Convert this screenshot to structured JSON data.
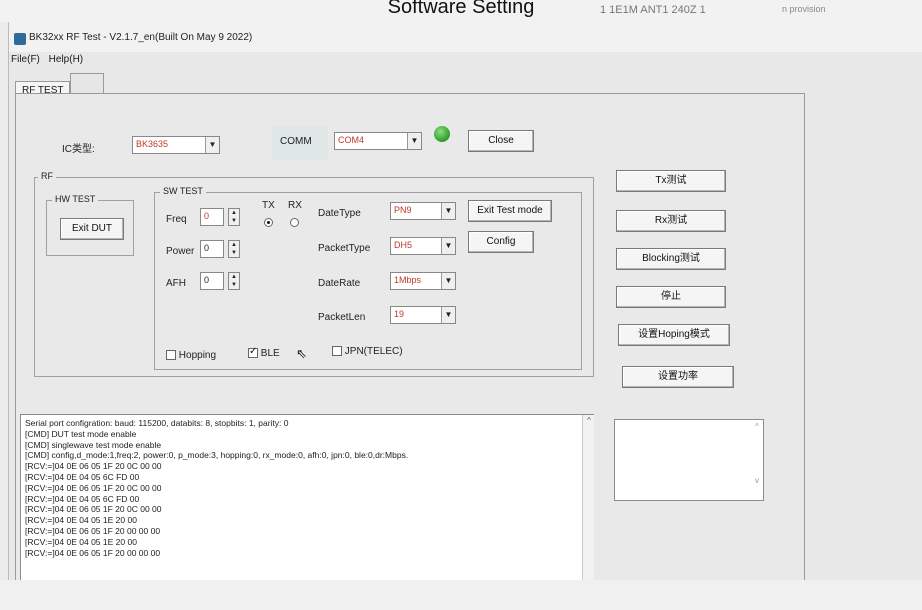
{
  "caption": "Software Setting",
  "background_text": {
    "left": "1  1E1M ANT1 240Z 1",
    "right": "n provision"
  },
  "window": {
    "title": "BK32xx RF Test - V2.1.7_en(Built On May  9 2022)",
    "menu": [
      "File(F)",
      "Help(H)"
    ]
  },
  "tabs": [
    "RF TEST",
    ""
  ],
  "top_row": {
    "ic_label": "IC类型:",
    "ic_value": "BK3635",
    "comm_label": "COMM",
    "comm_value": "COM4",
    "close_label": "Close",
    "led_color": "#2e9a2a"
  },
  "rf_group": {
    "title": "RF",
    "hw_test": {
      "title": "HW TEST",
      "exit_dut_label": "Exit DUT"
    },
    "sw_test": {
      "title": "SW TEST",
      "freq_label": "Freq",
      "freq_value": "0",
      "power_label": "Power",
      "power_value": "0",
      "afh_label": "AFH",
      "afh_value": "0",
      "tx_label": "TX",
      "rx_label": "RX",
      "tx_selected": true,
      "datetype_label": "DateType",
      "datetype_value": "PN9",
      "packettype_label": "PacketType",
      "packettype_value": "DH5",
      "daterate_label": "DateRate",
      "daterate_value": "1Mbps",
      "packetlen_label": "PacketLen",
      "packetlen_value": "19",
      "exit_test_mode_label": "Exit Test mode",
      "config_label": "Config",
      "hopping_label": "Hopping",
      "hopping_checked": false,
      "ble_label": "BLE",
      "ble_checked": true,
      "jpn_label": "JPN(TELEC)",
      "jpn_checked": false
    }
  },
  "right_buttons": [
    "Tx测试",
    "Rx测试",
    "Blocking测试",
    "停止",
    "设置Hoping模式",
    "设置功率"
  ],
  "log_lines": [
    "Serial port configration: baud: 115200, databits: 8, stopbits: 1, parity: 0",
    "[CMD] DUT test mode enable",
    "[CMD] singlewave test mode enable",
    "[CMD] config,d_mode:1,freq:2, power:0, p_mode:3, hopping:0, rx_mode:0, afh:0, jpn:0, ble:0,dr:Mbps.",
    "[RCV:=]04 0E 06 05 1F 20 0C 00 00",
    "[RCV:=]04 0E 04 05 6C FD 00",
    "[RCV:=]04 0E 06 05 1F 20 0C 00 00",
    "[RCV:=]04 0E 04 05 6C FD 00",
    "[RCV:=]04 0E 06 05 1F 20 0C 00 00",
    "[RCV:=]04 0E 04 05 1E 20 00",
    "[RCV:=]04 0E 06 05 1F 20 00 00 00",
    "[RCV:=]04 0E 04 05 1E 20 00",
    "[RCV:=]04 0E 06 05 1F 20 00 00 00"
  ]
}
